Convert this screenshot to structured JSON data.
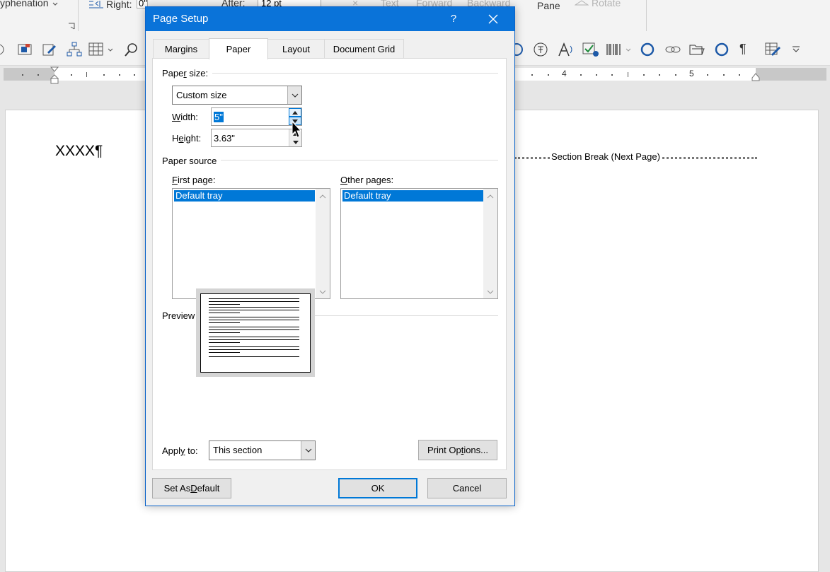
{
  "background": {
    "ribbon": {
      "hyphenation": "yphenation",
      "indent_right_label": "Right:",
      "indent_right_value": "0\"",
      "spacing_after_label": "After:",
      "spacing_after_value": "12 pt",
      "text_label": "Text",
      "forward_label": "Forward",
      "backward_label": "Backward",
      "pane_label": "Pane",
      "rotate_label": "Rotate"
    },
    "ruler_numbers": [
      "4",
      "5"
    ],
    "document": {
      "text": "XXXX¶",
      "section_break": "Section Break (Next Page)"
    }
  },
  "dialog": {
    "title": "Page Setup",
    "help_label": "?",
    "tabs": [
      {
        "label": "Margins"
      },
      {
        "label": "Paper"
      },
      {
        "label": "Layout"
      },
      {
        "label": "Document Grid"
      }
    ],
    "active_tab": "Paper",
    "paper_size": {
      "group_label_pre": "Pape",
      "group_label_key": "r",
      "group_label_post": " size:",
      "selected": "Custom size",
      "width_key": "W",
      "width_rest": "idth:",
      "width_value": "5\"",
      "height_pre": "H",
      "height_key": "e",
      "height_rest": "ight:",
      "height_value": "3.63\""
    },
    "paper_source": {
      "group_label": "Paper source",
      "first_page_key": "F",
      "first_page_rest": "irst page:",
      "first_page_selected": "Default tray",
      "other_pages_key": "O",
      "other_pages_rest": "ther pages:",
      "other_pages_selected": "Default tray"
    },
    "preview": {
      "label": "Preview"
    },
    "apply_to": {
      "label_pre": "Appl",
      "label_key": "y",
      "label_post": " to:",
      "value": "This section"
    },
    "buttons": {
      "print_options_pre": "Print Op",
      "print_options_key": "t",
      "print_options_post": "ions...",
      "set_default_pre": "Set As ",
      "set_default_key": "D",
      "set_default_post": "efault",
      "ok": "OK",
      "cancel": "Cancel"
    }
  },
  "colors": {
    "titlebar": "#0a73d9",
    "selection": "#0078d7",
    "dialog_bg": "#f0f0f0"
  }
}
